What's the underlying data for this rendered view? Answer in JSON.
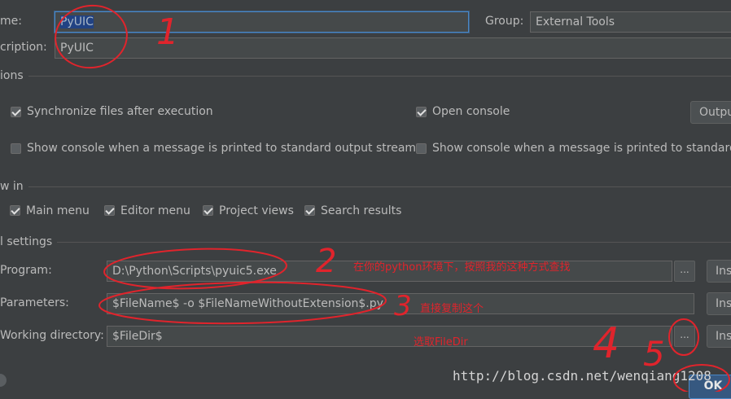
{
  "form": {
    "name_label": "me:",
    "name_value": "PyUIC",
    "group_label": "Group:",
    "group_value": "External Tools",
    "description_label": "cription:",
    "description_value": "PyUIC"
  },
  "options": {
    "section_label": "ions",
    "sync_files": "Synchronize files after execution",
    "open_console": "Open console",
    "output_button": "Outpu",
    "show_console_stdout": "Show console when a message is printed to standard output stream",
    "show_console_stderr": "Show console when a message is printed to standard e"
  },
  "show_in": {
    "section_label": "w in",
    "main_menu": "Main menu",
    "editor_menu": "Editor menu",
    "project_views": "Project views",
    "search_results": "Search results"
  },
  "tool_settings": {
    "section_label": "l settings",
    "program_label": "Program:",
    "program_value": "D:\\Python\\Scripts\\pyuic5.exe",
    "parameters_label": "Parameters:",
    "parameters_value": "$FileName$ -o $FileNameWithoutExtension$.py",
    "working_dir_label": "Working directory:",
    "working_dir_value": "$FileDir$",
    "browse_label": "...",
    "insert_label": "Ins"
  },
  "annotations": {
    "num1": "1",
    "num2": "2",
    "num3": "3",
    "num4": "4",
    "num5": "5",
    "note_program": "在你的python环境下，按照我的这种方式查找",
    "note_parameters": "直接复制这个",
    "note_workdir": "选取FileDir"
  },
  "footer": {
    "ok_button": "OK",
    "watermark": "http://blog.csdn.net/wenqiang1208"
  },
  "colors": {
    "background": "#3c3f41",
    "field": "#45494a",
    "annotation_red": "#e0242c",
    "focus_blue": "#4a88c7"
  }
}
